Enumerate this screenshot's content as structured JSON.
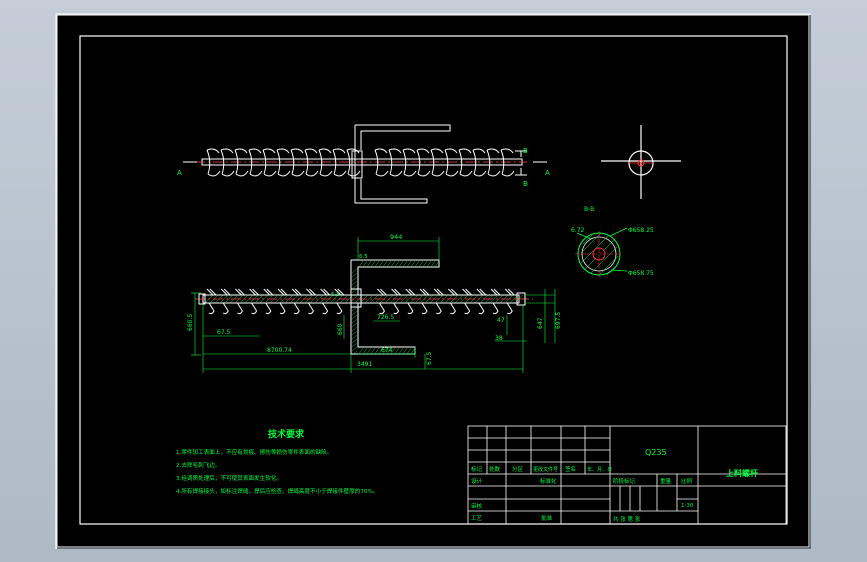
{
  "section_label": "B-B",
  "marks": {
    "A": "A",
    "B": "B"
  },
  "dims": {
    "width_944": "944",
    "top_offset": "6.5",
    "left_height": "660.5",
    "left_small": "67.5",
    "pitch": "8700.74",
    "mid_length": "726.5",
    "mid_height": "660",
    "bottom_seg": "674",
    "bottom_small": "67.5",
    "right_a": "47",
    "right_b": "647",
    "right_c": "697.5",
    "right_d": "38",
    "total": "3491",
    "left_r": "6.72",
    "dia_a": "Φ658.25",
    "dia_b": "Φ658.75",
    "axis_a": "6.5"
  },
  "tech": {
    "heading": "技术要求",
    "items": [
      "1.零件加工表面上，不应有划痕、擦伤等损伤零件表面的缺陷。",
      "2.去除毛刺飞边。",
      "3.经调质处理后，不可使其表面发生软化。",
      "4.所有焊接接头，如标注焊缝，焊后应检查。焊缝高度不小于焊接件壁厚的70%。"
    ]
  },
  "titleblock": {
    "material": "Q235",
    "part_name": "上料螺杆",
    "row_labels": [
      "标记",
      "处数",
      "分区",
      "更改文件号",
      "签名",
      "年、月、日"
    ],
    "designer": "设计",
    "standardize": "标准化",
    "review": "审核",
    "process": "工艺",
    "approve": "批准",
    "stage_header": "阶段标记",
    "weight_header": "重量",
    "scale_header": "比例",
    "scale_value": "1:30",
    "sheets": "共  张  第  张"
  }
}
